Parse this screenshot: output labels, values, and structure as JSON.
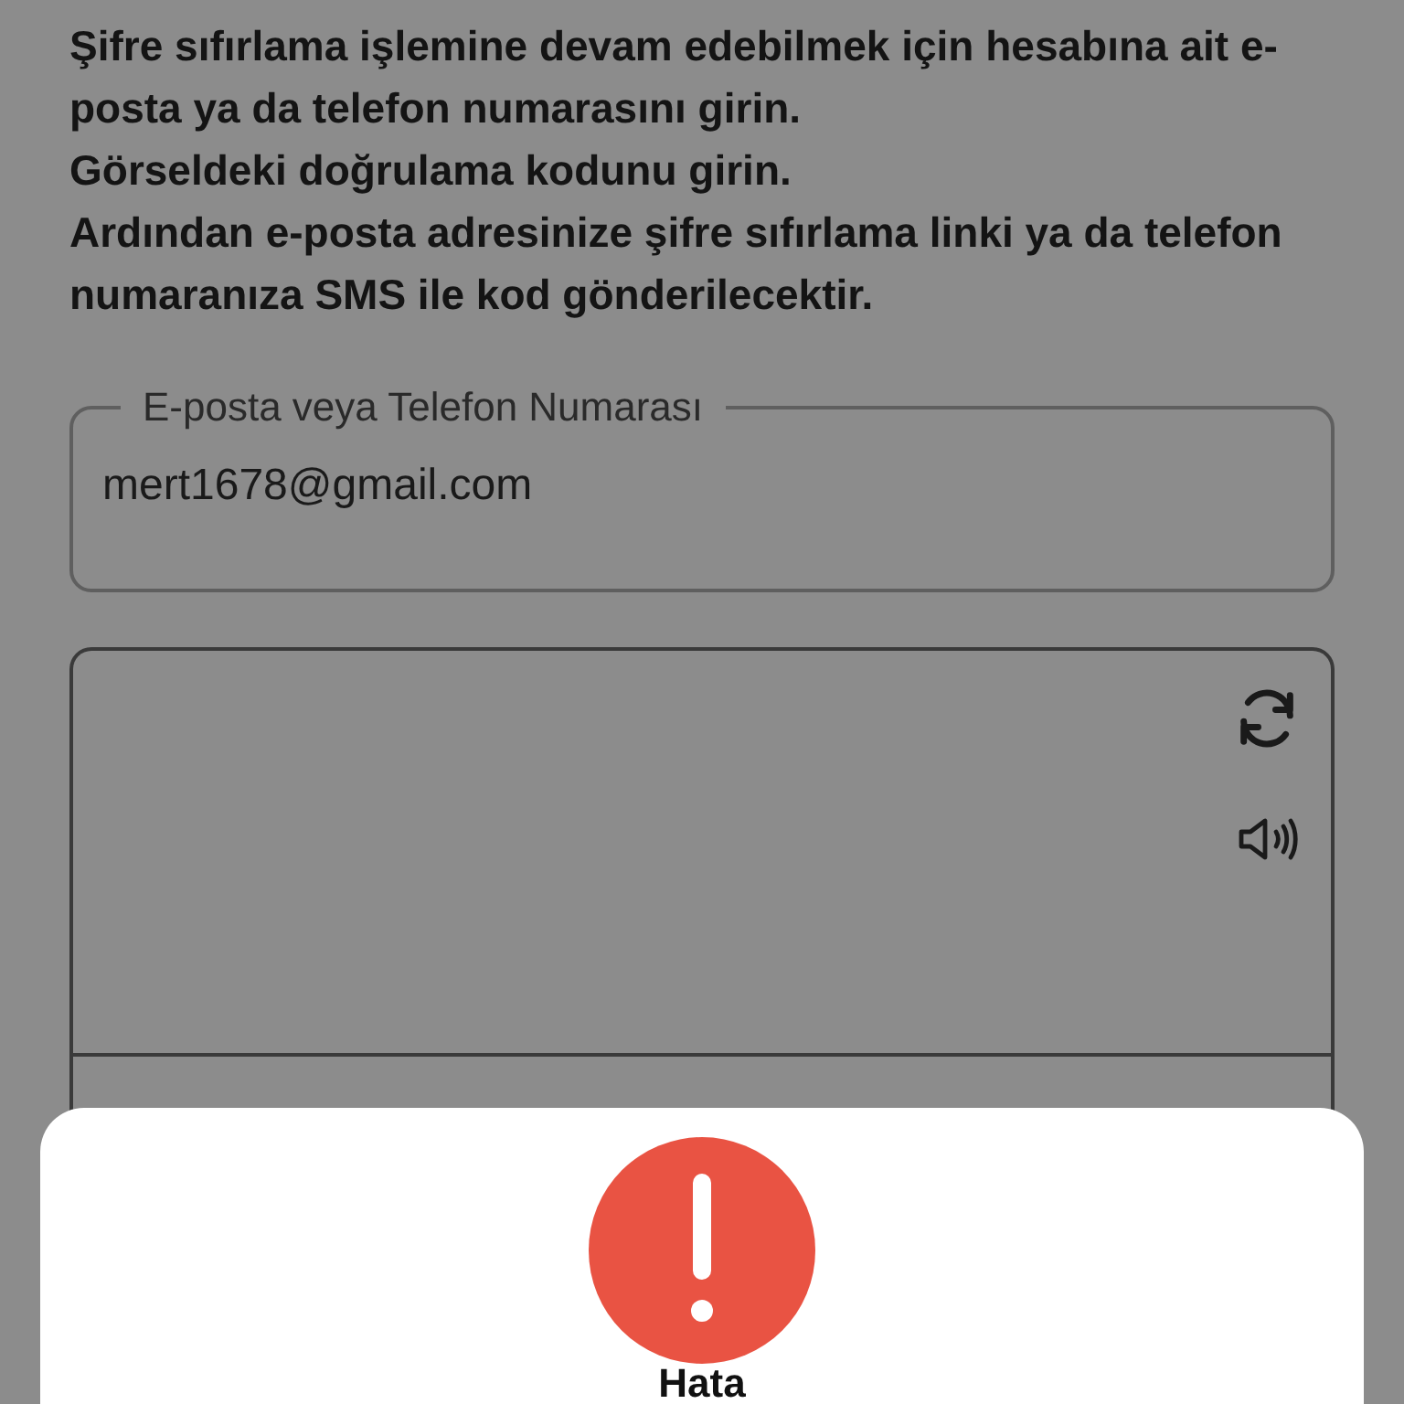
{
  "instructions": [
    "Şifre sıfırlama işlemine devam edebilmek için hesabına ait e-posta ya da telefon numarasını girin.",
    "Görseldeki doğrulama kodunu girin.",
    "Ardından e-posta adresinize şifre sıfırlama linki ya da telefon numaranıza SMS ile kod gönderilecektir."
  ],
  "email_field": {
    "label": "E-posta veya Telefon Numarası",
    "value": "mert1678@gmail.com"
  },
  "alert": {
    "kind": "error",
    "title": "Hata"
  }
}
